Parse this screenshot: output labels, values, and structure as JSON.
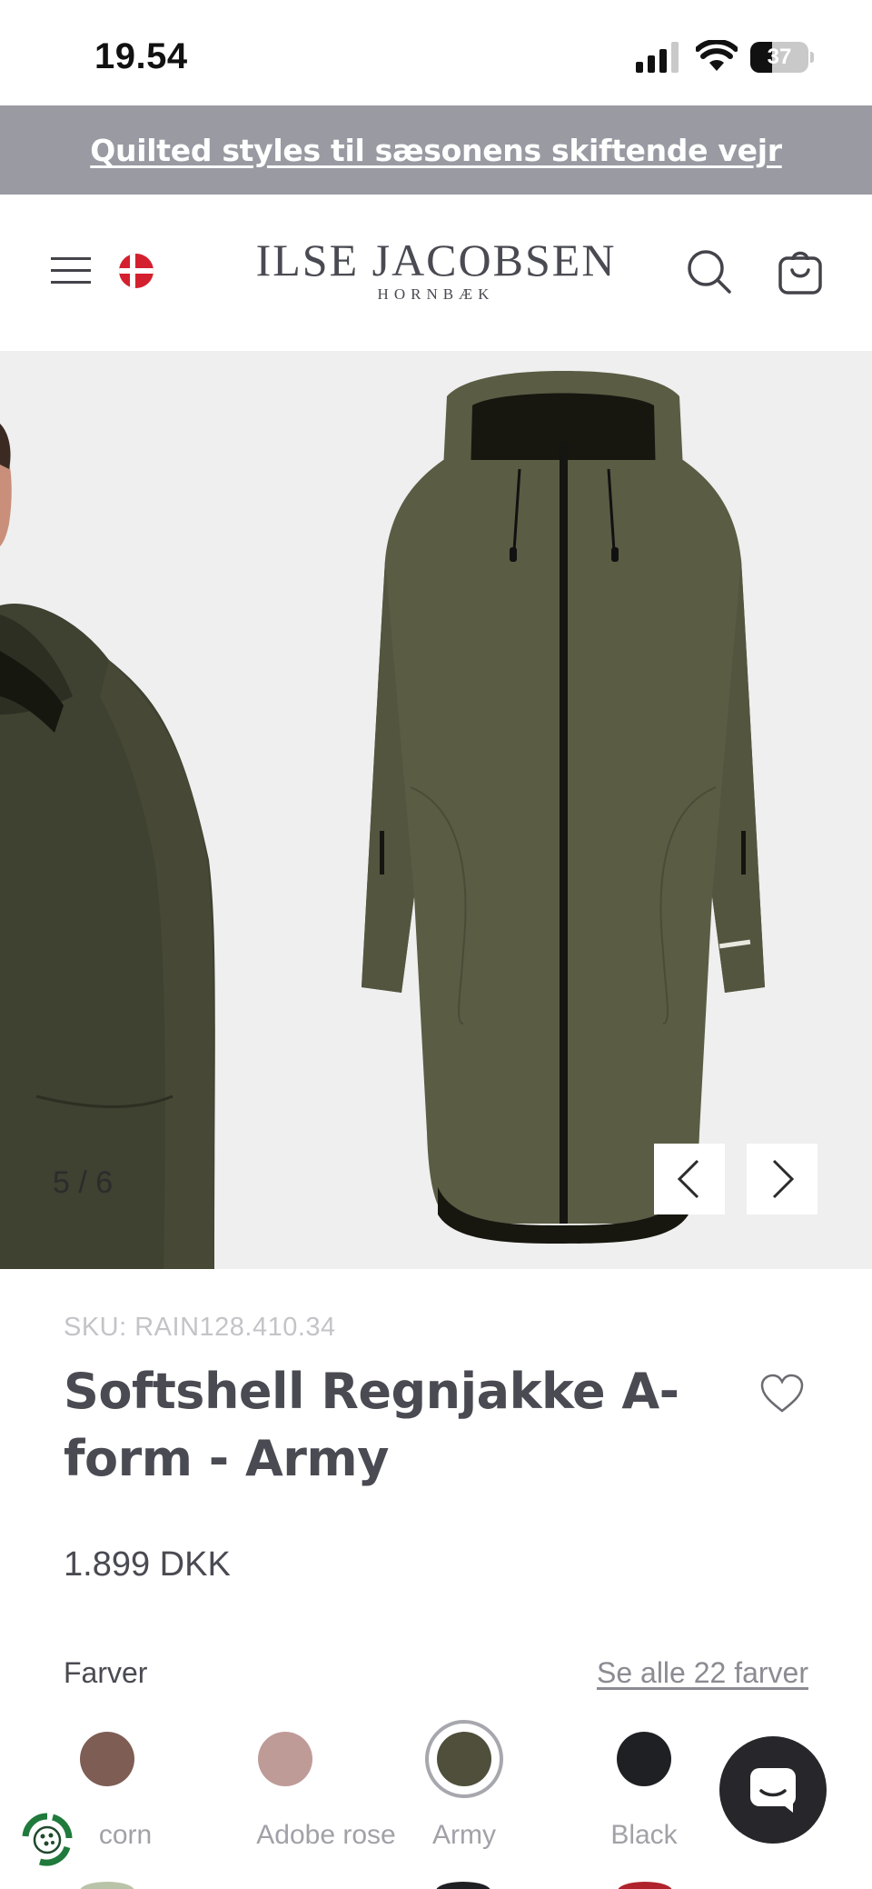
{
  "status_bar": {
    "time": "19.54",
    "battery": "37",
    "battery_level": 0.37
  },
  "announcement": {
    "text": "Quilted styles til sæsonens skiftende vejr"
  },
  "header": {
    "logo_main": "ILSE JACOBSEN",
    "logo_sub": "HORNBÆK"
  },
  "gallery": {
    "counter": "5 / 6"
  },
  "product": {
    "sku": "SKU: RAIN128.410.34",
    "title": "Softshell Regnjakke A-form - Army",
    "price": "1.899 DKK"
  },
  "colors": {
    "label": "Farver",
    "see_all": "Se alle 22 farver",
    "swatches": [
      {
        "name": "corn",
        "color": "#7e5d54"
      },
      {
        "name": "Adobe rose",
        "color": "#bf9b98"
      },
      {
        "name": "Army",
        "color": "#4f4f3c",
        "selected": true
      },
      {
        "name": "Black",
        "color": "#1f2024"
      }
    ]
  },
  "palette": {
    "coat": "#5a5c44",
    "coat_dark": "#3f4131",
    "announce_bg": "#999aa2",
    "flag_red": "#d4202e"
  }
}
